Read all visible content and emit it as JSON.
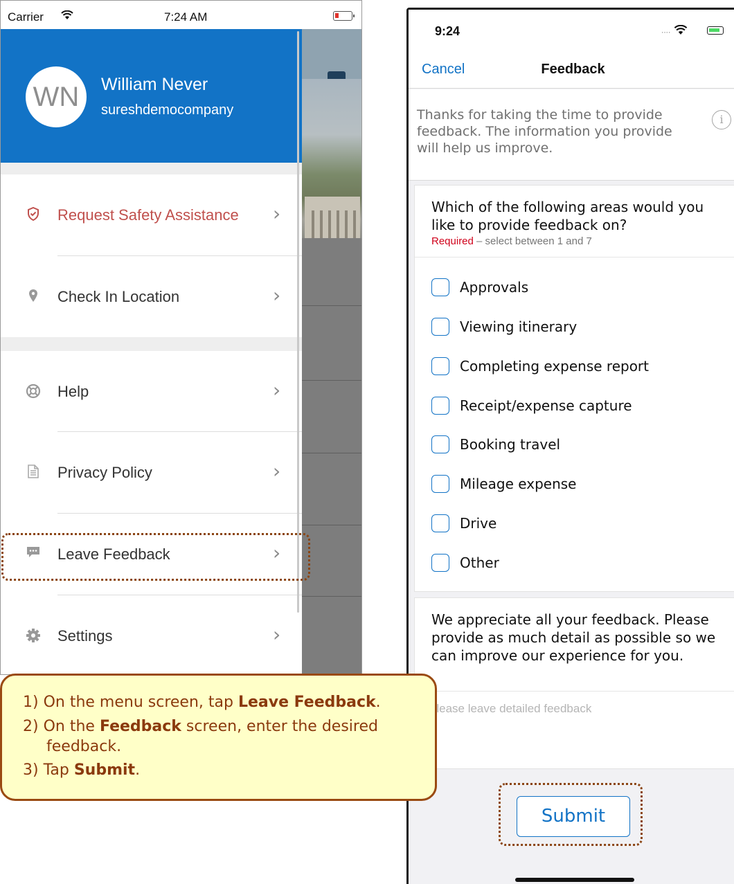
{
  "left_screen": {
    "status_bar": {
      "carrier": "Carrier",
      "wifi_icon": "wifi-icon",
      "time": "7:24 AM"
    },
    "profile": {
      "initials": "WN",
      "name": "William Never",
      "company": "sureshdemocompany"
    },
    "menu_items": [
      {
        "label": "Request Safety Assistance",
        "icon": "shield-icon",
        "color": "#c0504d"
      },
      {
        "label": "Check In Location",
        "icon": "location-pin-icon"
      },
      {
        "label": "Help",
        "icon": "lifebuoy-icon"
      },
      {
        "label": "Privacy Policy",
        "icon": "document-icon"
      },
      {
        "label": "Leave Feedback",
        "icon": "chat-bubble-icon"
      },
      {
        "label": "Settings",
        "icon": "gear-icon"
      }
    ],
    "chevron": "›",
    "header_color": "#1273c6"
  },
  "right_screen": {
    "status_bar": {
      "time": "9:24",
      "signal": "....",
      "wifi": "wifi-icon",
      "battery": "battery-charging-icon"
    },
    "nav": {
      "cancel_label": "Cancel",
      "title": "Feedback"
    },
    "intro_text": "Thanks for taking the time to provide feedback.  The information you provide will help us improve.",
    "info_icon": "i",
    "question": {
      "text": "Which of the following areas would you like to provide feedback on?",
      "required_label": "Required",
      "hint_suffix": " – select between 1 and 7",
      "options": [
        "Approvals",
        "Viewing itinerary",
        "Completing expense report",
        "Receipt/expense capture",
        "Booking travel",
        "Mileage expense",
        "Drive",
        "Other"
      ]
    },
    "detail": {
      "text": "We appreciate all your feedback. Please provide as much detail as possible so we can improve our experience for you.",
      "placeholder": "Please leave detailed feedback"
    },
    "submit_label": "Submit",
    "accent_color": "#1273c6"
  },
  "instructions": {
    "step1": {
      "prefix": "1) On the menu screen, tap ",
      "bold": "Leave Feedback",
      "suffix": "."
    },
    "step2": {
      "prefix": "2) On the ",
      "bold": "Feedback",
      "suffix": " screen, enter the desired",
      "continuation": "feedback."
    },
    "step3": {
      "prefix": "3) Tap ",
      "bold": "Submit",
      "suffix": "."
    }
  }
}
